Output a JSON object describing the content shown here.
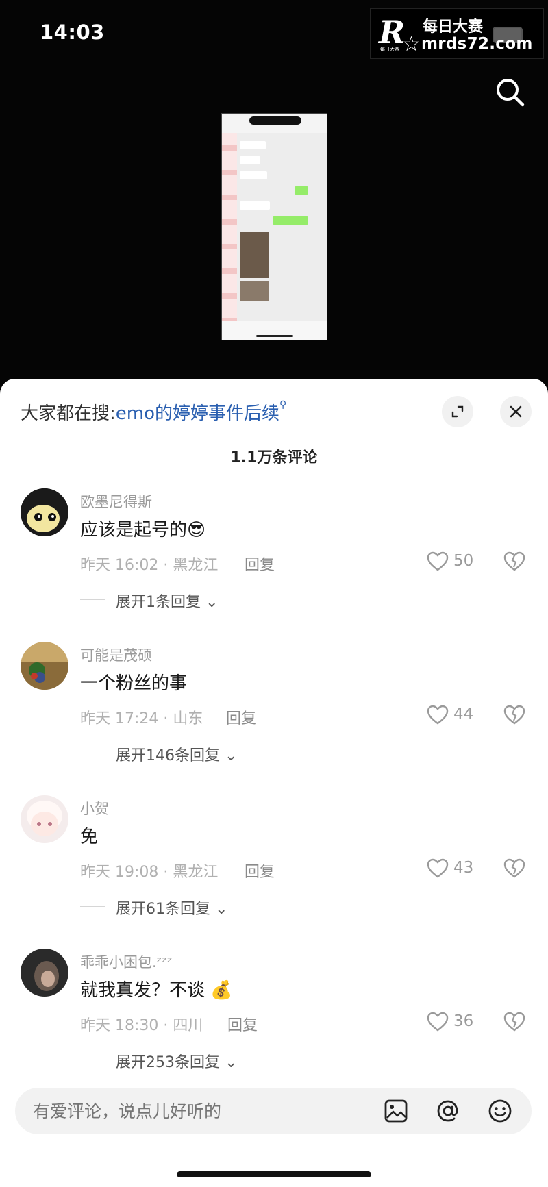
{
  "status_bar": {
    "time": "14:03"
  },
  "watermark": {
    "logo_letter": "R",
    "logo_sub": "每日大赛",
    "title": "每日大赛",
    "url": "mrds72.com"
  },
  "icons": {
    "search": "search-icon",
    "expand": "expand-icon",
    "close": "close-icon",
    "like": "heart-icon",
    "dislike": "broken-heart-icon",
    "image": "image-icon",
    "mention": "at-icon",
    "emoji": "emoji-icon"
  },
  "sheet": {
    "search_hint_prefix": "大家都在搜:",
    "search_hint_keyword": "emo的婷婷事件后续",
    "comment_count": "1.1万条评论"
  },
  "comments": [
    {
      "name": "欧墨尼得斯",
      "text": "应该是起号的😎",
      "meta": "昨天 16:02 · 黑龙江",
      "reply": "回复",
      "likes": "50",
      "expand": "展开1条回复"
    },
    {
      "name": "可能是茂硕",
      "text": "一个粉丝的事",
      "meta": "昨天 17:24 · 山东",
      "reply": "回复",
      "likes": "44",
      "expand": "展开146条回复"
    },
    {
      "name": "小贺",
      "text": "免",
      "meta": "昨天 19:08 · 黑龙江",
      "reply": "回复",
      "likes": "43",
      "expand": "展开61条回复"
    },
    {
      "name": "乖乖小困包.ᶻᶻᶻ",
      "text": "就我真发？不谈 💰",
      "meta": "昨天 18:30 · 四川",
      "reply": "回复",
      "likes": "36",
      "expand": "展开253条回复"
    }
  ],
  "input": {
    "placeholder": "有爱评论，说点儿好听的"
  },
  "colors": {
    "keyword": "#2a5fb0",
    "sheet_bg": "#ffffff",
    "video_bg": "#050505"
  }
}
